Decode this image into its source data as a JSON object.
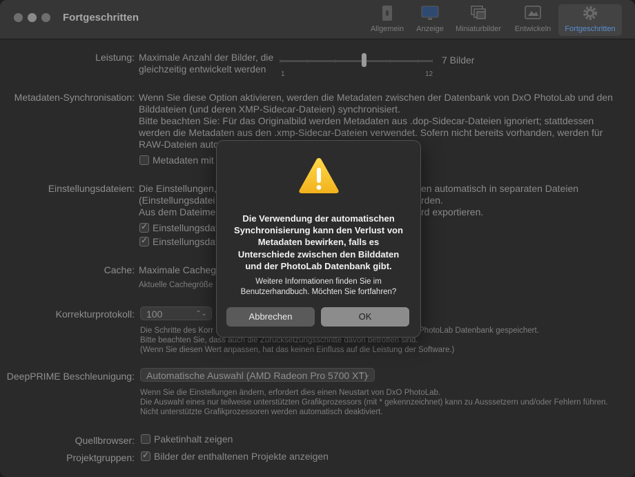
{
  "window": {
    "title": "Fortgeschritten"
  },
  "toolbar": {
    "tabs": [
      {
        "label": "Allgemein",
        "icon": "phone-switch-icon"
      },
      {
        "label": "Anzeige",
        "icon": "display-icon"
      },
      {
        "label": "Miniaturbilder",
        "icon": "thumbnails-icon"
      },
      {
        "label": "Entwickeln",
        "icon": "develop-icon"
      },
      {
        "label": "Fortgeschritten",
        "icon": "gear-icon",
        "active": true
      }
    ]
  },
  "settings": {
    "leistung": {
      "label": "Leistung:",
      "text1": "Maximale Anzahl der Bilder, die",
      "text2": "gleichzeitig entwickelt werden",
      "value_text": "7 Bilder",
      "min": "1",
      "max": "12",
      "value": 7
    },
    "metadaten": {
      "label": "Metadaten-Synchronisation:",
      "line1": "Wenn Sie diese Option aktivieren, werden die Metadaten zwischen der Datenbank von DxO PhotoLab und den",
      "line2": "Bilddateien (und deren XMP-Sidecar-Dateien) synchronisiert.",
      "line3": "Bitte beachten Sie: Für das Originalbild werden Metadaten aus .dop-Sidecar-Dateien ignoriert; stattdessen",
      "line4": "werden die Metadaten aus den .xmp-Sidecar-Dateien verwendet. Sofern nicht bereits vorhanden, werden für",
      "line5": "RAW-Dateien auto",
      "checkbox": "Metadaten mit"
    },
    "einstellung": {
      "label": "Einstellungsdateien:",
      "line1a": "Die Einstellungen,",
      "line1b": "en automatisch in separaten Dateien",
      "line2a": "(Einstellungsdatei",
      "line2b": "rden.",
      "line3a": "Aus dem Dateimen",
      "line3b": "rd exportieren.",
      "check1": "Einstellungsdat",
      "check2": "Einstellungsdat"
    },
    "cache": {
      "label": "Cache:",
      "line1": "Maximale Cachegr",
      "line2": "Aktuelle Cachegröße"
    },
    "korrektur": {
      "label": "Korrekturprotokoll:",
      "value": "100",
      "line1a": "Die Schritte des Korr",
      "line1b": "PhotoLab Datenbank gespeichert.",
      "line2": "Bitte beachten Sie, dass auch die Zurücksetzungsschritte davon betroffen sind.",
      "line3": "(Wenn Sie diesen Wert anpassen, hat das keinen Einfluss auf die Leistung der Software.)"
    },
    "deepprime": {
      "label": "DeepPRIME Beschleunigung:",
      "value": "Automatische Auswahl (AMD Radeon Pro 5700 XT)",
      "line1": "Wenn Sie die Einstellungen ändern, erfordert dies einen Neustart von DxO PhotoLab.",
      "line2": "Die Auswahl eines nur teilweise unterstützten Grafikprozessors (mit * gekennzeichnet) kann zu Ausssetzern und/oder Fehlern führen.",
      "line3": "Nicht unterstützte Grafikprozessoren werden automatisch deaktiviert."
    },
    "quellbrowser": {
      "label": "Quellbrowser:",
      "checkbox": "Paketinhalt zeigen"
    },
    "projektgruppen": {
      "label": "Projektgruppen:",
      "checkbox": "Bilder der enthaltenen Projekte anzeigen"
    }
  },
  "dialog": {
    "title_lines": [
      "Die Verwendung der automatischen",
      "Synchronisierung kann den Verlust von",
      "Metadaten bewirken, falls es",
      "Unterschiede zwischen den Bilddaten",
      "und der PhotoLab Datenbank gibt."
    ],
    "msg_lines": [
      "Weitere Informationen finden Sie im",
      "Benutzerhandbuch. Möchten Sie fortfahren?"
    ],
    "cancel": "Abbrechen",
    "ok": "OK"
  }
}
